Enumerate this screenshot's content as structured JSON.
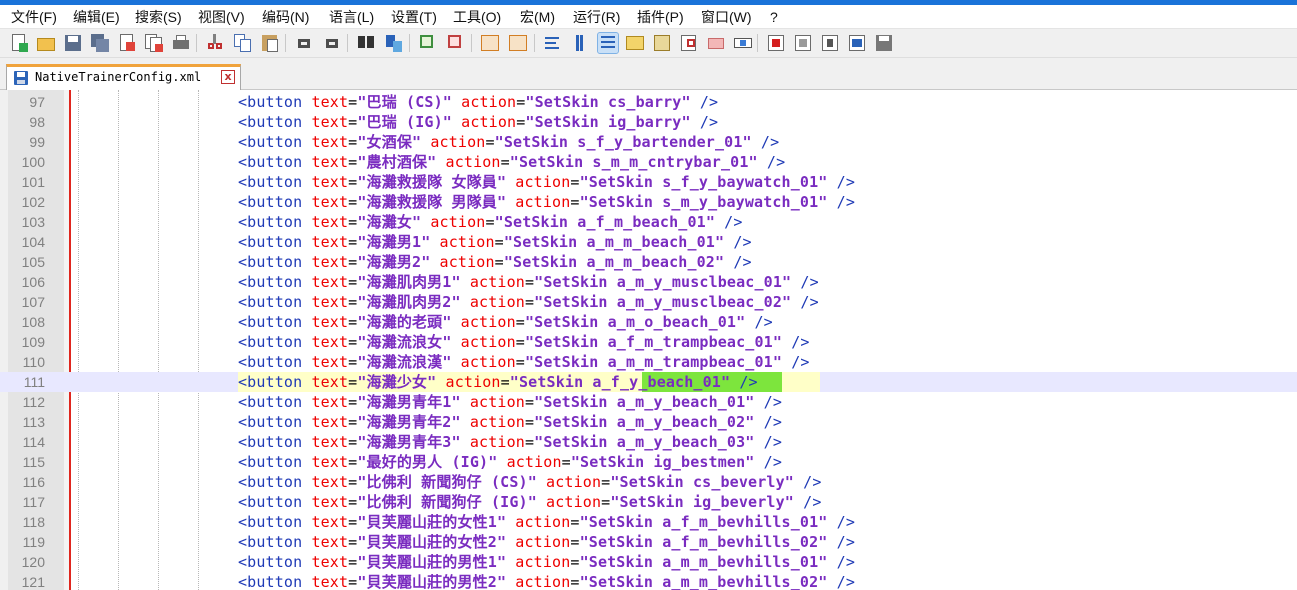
{
  "menu": [
    "文件(F)",
    "编辑(E)",
    "搜索(S)",
    "视图(V)",
    "编码(N)",
    "语言(L)",
    "设置(T)",
    "工具(O)",
    "宏(M)",
    "运行(R)",
    "插件(P)",
    "窗口(W)",
    "?"
  ],
  "toolbar": {
    "icons": [
      "new-file-icon",
      "open-file-icon",
      "save-icon",
      "save-all-icon",
      "close-icon",
      "close-all-icon",
      "print-icon",
      "cut-icon",
      "copy-icon",
      "paste-icon",
      "undo-icon",
      "redo-icon",
      "find-icon",
      "replace-icon",
      "zoom-in-icon",
      "zoom-out-icon",
      "sync-vertical-icon",
      "sync-horizontal-icon",
      "word-wrap-icon",
      "show-all-chars-icon",
      "indent-guide-icon",
      "document-map-icon",
      "function-list-icon",
      "folder-workspace-icon",
      "monitoring-icon",
      "view-icon",
      "record-macro-icon",
      "stop-recording-icon",
      "play-macro-icon",
      "run-macro-multiple-icon",
      "save-macro-icon"
    ]
  },
  "tab": {
    "label": "NativeTrainerConfig.xml",
    "close": "x"
  },
  "editor": {
    "current_line": "111",
    "lines": [
      {
        "num": "97",
        "text": "巴瑞 (CS)",
        "action": "SetSkin cs_barry"
      },
      {
        "num": "98",
        "text": "巴瑞 (IG)",
        "action": "SetSkin ig_barry"
      },
      {
        "num": "99",
        "text": "女酒保",
        "action": "SetSkin s_f_y_bartender_01"
      },
      {
        "num": "100",
        "text": "農村酒保",
        "action": "SetSkin s_m_m_cntrybar_01"
      },
      {
        "num": "101",
        "text": "海灘救援隊 女隊員",
        "action": "SetSkin s_f_y_baywatch_01"
      },
      {
        "num": "102",
        "text": "海灘救援隊 男隊員",
        "action": "SetSkin s_m_y_baywatch_01"
      },
      {
        "num": "103",
        "text": "海灘女",
        "action": "SetSkin a_f_m_beach_01"
      },
      {
        "num": "104",
        "text": "海灘男1",
        "action": "SetSkin a_m_m_beach_01"
      },
      {
        "num": "105",
        "text": "海灘男2",
        "action": "SetSkin a_m_m_beach_02"
      },
      {
        "num": "106",
        "text": "海灘肌肉男1",
        "action": "SetSkin a_m_y_musclbeac_01"
      },
      {
        "num": "107",
        "text": "海灘肌肉男2",
        "action": "SetSkin a_m_y_musclbeac_02"
      },
      {
        "num": "108",
        "text": "海灘的老頭",
        "action": "SetSkin a_m_o_beach_01"
      },
      {
        "num": "109",
        "text": "海灘流浪女",
        "action": "SetSkin a_f_m_trampbeac_01"
      },
      {
        "num": "110",
        "text": "海灘流浪漢",
        "action": "SetSkin a_m_m_trampbeac_01"
      },
      {
        "num": "111",
        "text": "海灘少女",
        "action": "SetSkin a_f_y_beach_01"
      },
      {
        "num": "112",
        "text": "海灘男青年1",
        "action": "SetSkin a_m_y_beach_01"
      },
      {
        "num": "113",
        "text": "海灘男青年2",
        "action": "SetSkin a_m_y_beach_02"
      },
      {
        "num": "114",
        "text": "海灘男青年3",
        "action": "SetSkin a_m_y_beach_03"
      },
      {
        "num": "115",
        "text": "最好的男人 (IG)",
        "action": "SetSkin ig_bestmen"
      },
      {
        "num": "116",
        "text": "比佛利 新聞狗仔 (CS)",
        "action": "SetSkin cs_beverly"
      },
      {
        "num": "117",
        "text": "比佛利 新聞狗仔 (IG)",
        "action": "SetSkin ig_beverly"
      },
      {
        "num": "118",
        "text": "貝芙麗山莊的女性1",
        "action": "SetSkin a_f_m_bevhills_01"
      },
      {
        "num": "119",
        "text": "貝芙麗山莊的女性2",
        "action": "SetSkin a_f_m_bevhills_02"
      },
      {
        "num": "120",
        "text": "貝芙麗山莊的男性1",
        "action": "SetSkin a_m_m_bevhills_01"
      },
      {
        "num": "121",
        "text": "貝芙麗山莊的男性2",
        "action": "SetSkin a_m_m_bevhills_02"
      }
    ]
  }
}
